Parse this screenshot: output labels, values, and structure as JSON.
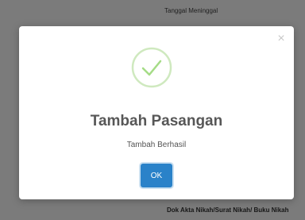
{
  "background": {
    "top_label": "Tanggal Meninggal",
    "bottom_label": "Dok Akta Nikah/Surat Nikah/ Buku Nikah"
  },
  "modal": {
    "close_icon": "close-icon",
    "success_icon": "check-circle-icon",
    "title": "Tambah Pasangan",
    "message": "Tambah Berhasil",
    "ok_label": "OK"
  },
  "colors": {
    "backdrop": "#7b7b7b",
    "modal_bg": "#ffffff",
    "success_green": "#a5dc86",
    "button_blue": "#2a82c9"
  }
}
